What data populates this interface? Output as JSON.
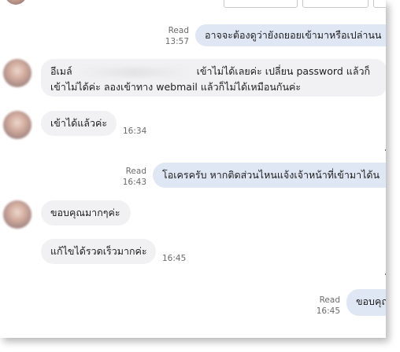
{
  "messages": [
    {
      "direction": "out",
      "text": "อาจจะต้องดูว่ายังถยอยเข้ามาหรือเปล่านน",
      "read": "Read",
      "time": "13:57"
    },
    {
      "direction": "in",
      "line1_a": "อีเมล์",
      "line1_b": "เข้าไม่ได้เลยค่ะ เปลี่ยน password แล้วก็",
      "line2": "เข้าไม่ได้ค่ะ ลองเข้าทาง webmail แล้วก็ไม่ได้เหมือนกันค่ะ"
    },
    {
      "direction": "in",
      "text": "เข้าได้แล้วค่ะ",
      "time": "16:34"
    },
    {
      "direction": "out",
      "text": "โอเครครับ หากติดส่วนไหนแจ้งเจ้าหน้าที่เข้ามาได้น",
      "read": "Read",
      "time": "16:43"
    },
    {
      "direction": "in",
      "text": "ขอบคุณมากๆค่ะ"
    },
    {
      "direction": "in",
      "text": "แก้ไขได้รวดเร็วมากค่ะ",
      "time": "16:45"
    },
    {
      "direction": "out",
      "text": "ขอบคุณ",
      "read": "Read",
      "time": "16:45"
    }
  ]
}
